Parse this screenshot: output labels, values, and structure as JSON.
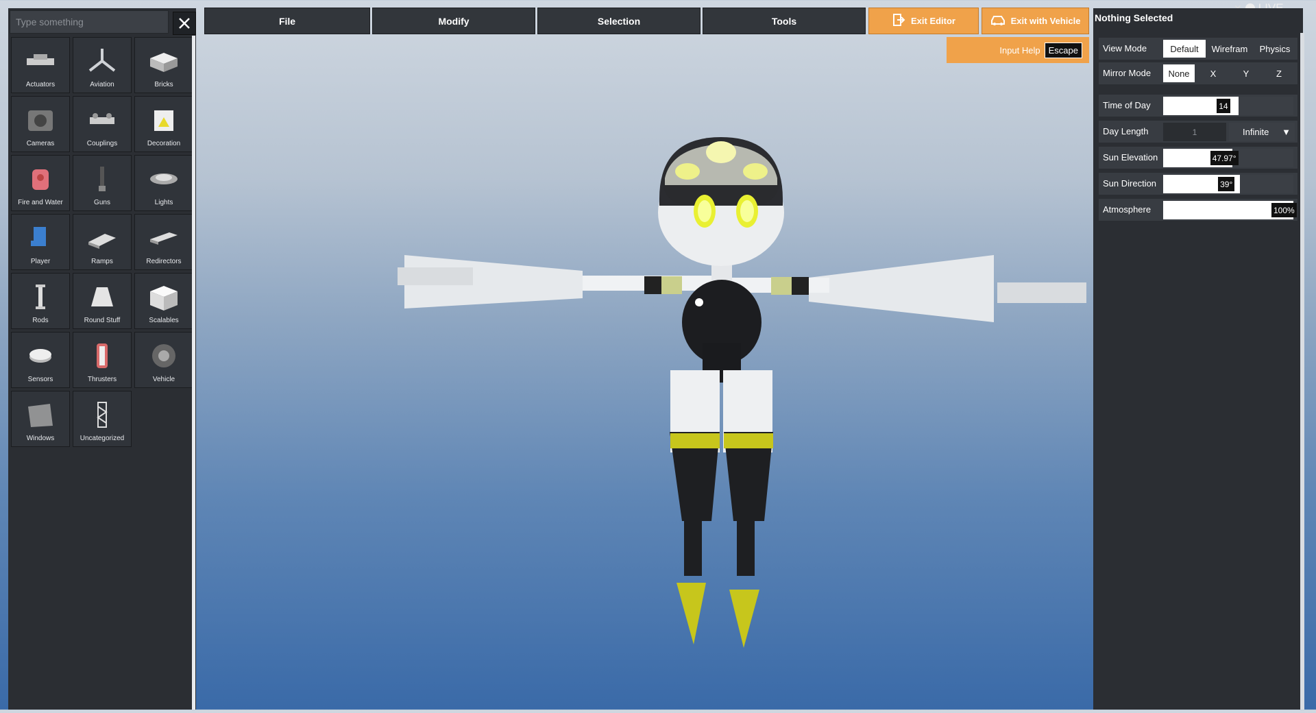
{
  "search": {
    "placeholder": "Type something"
  },
  "palette": {
    "items": [
      {
        "label": "Actuators",
        "icon": "actuator-icon"
      },
      {
        "label": "Aviation",
        "icon": "propeller-icon"
      },
      {
        "label": "Bricks",
        "icon": "brick-icon"
      },
      {
        "label": "Cameras",
        "icon": "camera-icon"
      },
      {
        "label": "Couplings",
        "icon": "coupling-icon"
      },
      {
        "label": "Decoration",
        "icon": "decoration-icon"
      },
      {
        "label": "Fire and Water",
        "icon": "fire-water-icon"
      },
      {
        "label": "Guns",
        "icon": "gun-icon"
      },
      {
        "label": "Lights",
        "icon": "light-icon"
      },
      {
        "label": "Player",
        "icon": "seat-icon"
      },
      {
        "label": "Ramps",
        "icon": "ramp-icon"
      },
      {
        "label": "Redirectors",
        "icon": "redirector-icon"
      },
      {
        "label": "Rods",
        "icon": "rod-icon"
      },
      {
        "label": "Round Stuff",
        "icon": "cone-icon"
      },
      {
        "label": "Scalables",
        "icon": "cube-icon"
      },
      {
        "label": "Sensors",
        "icon": "sensor-icon"
      },
      {
        "label": "Thrusters",
        "icon": "thruster-icon"
      },
      {
        "label": "Vehicle",
        "icon": "wheel-icon"
      },
      {
        "label": "Windows",
        "icon": "window-icon"
      },
      {
        "label": "Uncategorized",
        "icon": "truss-icon"
      }
    ]
  },
  "menu": {
    "file": "File",
    "modify": "Modify",
    "selection": "Selection",
    "tools": "Tools"
  },
  "actions": {
    "exit_editor": "Exit Editor",
    "exit_vehicle": "Exit with Vehicle"
  },
  "input_help": {
    "label": "Input Help",
    "key": "Escape"
  },
  "status": {
    "live": "LIVE"
  },
  "selection_panel": {
    "title": "Nothing Selected",
    "view_mode": {
      "label": "View Mode",
      "options": [
        "Default",
        "Wirefram",
        "Physics"
      ],
      "selected": "Default"
    },
    "mirror_mode": {
      "label": "Mirror Mode",
      "options": [
        "None",
        "X",
        "Y",
        "Z"
      ],
      "selected": "None"
    },
    "time_of_day": {
      "label": "Time of Day",
      "value": "14",
      "fraction": 0.58
    },
    "day_length": {
      "label": "Day Length",
      "value": "1",
      "unit": "Infinite"
    },
    "sun_elevation": {
      "label": "Sun Elevation",
      "value": "47.97°",
      "fraction": 0.53
    },
    "sun_direction": {
      "label": "Sun Direction",
      "value": "39°",
      "fraction": 0.59
    },
    "atmosphere": {
      "label": "Atmosphere",
      "value": "100%",
      "fraction": 1.0
    }
  },
  "colors": {
    "accent": "#f0a24a",
    "panel": "#2b2e33"
  }
}
